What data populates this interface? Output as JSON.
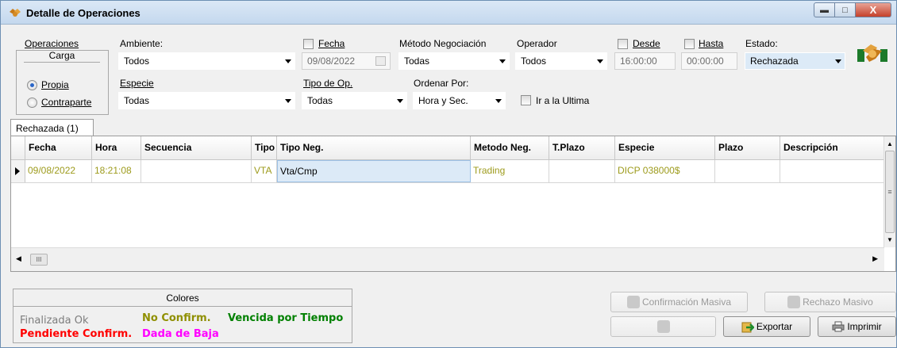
{
  "window": {
    "title": "Detalle de Operaciones",
    "min_glyph": "▬",
    "max_glyph": "□",
    "close_glyph": "X"
  },
  "filters": {
    "operaciones_label": "Operaciones",
    "carga_label": "Carga",
    "propia_label": "Propia",
    "contraparte_label": "Contraparte",
    "selected_carga": "Propia",
    "ambiente_label": "Ambiente:",
    "ambiente_value": "Todos",
    "especie_label": "Especie",
    "especie_value": "Todas",
    "fecha_label": "Fecha",
    "fecha_value": "09/08/2022",
    "fecha_checked": false,
    "tipo_op_label": "Tipo de Op.",
    "tipo_op_value": "Todas",
    "metodo_label": "Método Negociación",
    "metodo_value": "Todas",
    "ordenar_label": "Ordenar Por:",
    "ordenar_value": "Hora y Sec.",
    "operador_label": "Operador",
    "operador_value": "Todos",
    "ir_ultima_label": "Ir a la Ultima",
    "ir_ultima_checked": false,
    "desde_label": "Desde",
    "desde_value": "16:00:00",
    "desde_checked": false,
    "hasta_label": "Hasta",
    "hasta_value": "00:00:00",
    "hasta_checked": false,
    "estado_label": "Estado:",
    "estado_value": "Rechazada"
  },
  "tab": {
    "label": "Rechazada (1)"
  },
  "grid": {
    "columns": [
      "Fecha",
      "Hora",
      "Secuencia",
      "Tipo",
      "Tipo Neg.",
      "Metodo Neg.",
      "T.Plazo",
      "Especie",
      "Plazo",
      "Descripción"
    ],
    "rows": [
      {
        "fecha": "09/08/2022",
        "hora": "18:21:08",
        "secuencia": "",
        "tipo": "VTA",
        "tipo_neg": "Vta/Cmp",
        "metodo_neg": "Trading",
        "t_plazo": "",
        "especie": "DICP  038000$",
        "plazo": "",
        "descripcion": ""
      }
    ],
    "hscroll_glyph": "III",
    "vscroll_glyph": "≡"
  },
  "legend": {
    "title": "Colores",
    "finalizada": "Finalizada Ok",
    "no_confirm": "No Confirm.",
    "vencida": "Vencida por Tiempo",
    "pendiente": "Pendiente Confirm.",
    "dada_baja": "Dada de Baja",
    "colors": {
      "finalizada": "#7d7d7d",
      "no_confirm": "#8f8f00",
      "vencida": "#008000",
      "pendiente": "#ff0000",
      "dada_baja": "#ff00ff"
    }
  },
  "buttons": {
    "confirmacion_masiva": "Confirmación Masiva",
    "rechazo_masivo": "Rechazo Masivo",
    "exportar": "Exportar",
    "imprimir": "Imprimir"
  }
}
